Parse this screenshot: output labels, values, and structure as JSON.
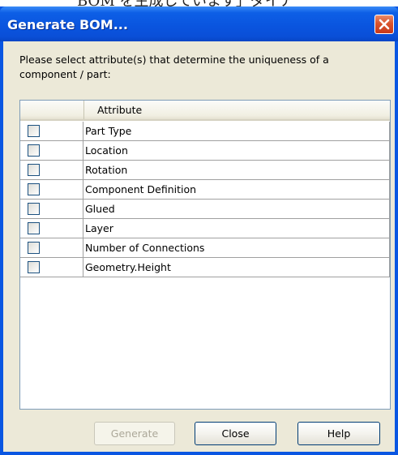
{
  "background_caption": "BOM を生成しています」ダイア",
  "window": {
    "title": "Generate BOM...",
    "close_icon": "close-icon"
  },
  "prompt": "Please select attribute(s) that determine the uniqueness of a component / part:",
  "grid": {
    "columns": [
      "",
      "Attribute"
    ],
    "rows": [
      {
        "checked": false,
        "label": "Part Type"
      },
      {
        "checked": false,
        "label": "Location"
      },
      {
        "checked": false,
        "label": "Rotation"
      },
      {
        "checked": false,
        "label": "Component Definition"
      },
      {
        "checked": false,
        "label": "Glued"
      },
      {
        "checked": false,
        "label": "Layer"
      },
      {
        "checked": false,
        "label": "Number of Connections"
      },
      {
        "checked": false,
        "label": "Geometry.Height"
      }
    ]
  },
  "buttons": {
    "generate": {
      "label": "Generate",
      "enabled": false
    },
    "close": {
      "label": "Close",
      "enabled": true
    },
    "help": {
      "label": "Help",
      "enabled": true
    }
  },
  "colors": {
    "titlebar": "#0a55df",
    "close_button": "#d9532c",
    "dialog_face": "#ece9d8",
    "grid_border": "#7f9db9",
    "checkbox_border": "#1c5180"
  }
}
